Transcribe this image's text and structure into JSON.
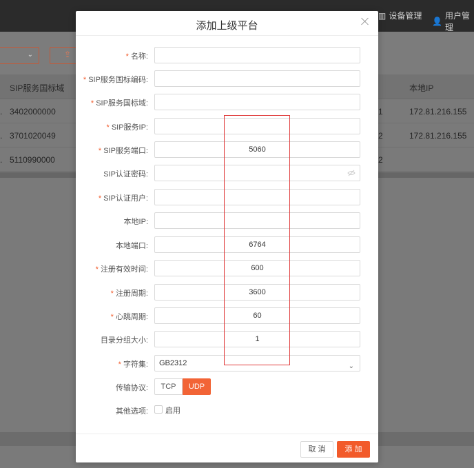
{
  "topnav": {
    "device_mgmt": "设备管理",
    "user_mgmt": "用户管理"
  },
  "bg_table": {
    "headers": [
      "SIP服务国标域",
      "本地IP"
    ],
    "rows": [
      {
        "prefix": ".",
        "domain": "3402000000",
        "mid": "1",
        "ip": "172.81.216.155"
      },
      {
        "prefix": ".",
        "domain": "3701020049",
        "mid": "2",
        "ip": "172.81.216.155"
      },
      {
        "prefix": ".",
        "domain": "5110990000",
        "mid": "2",
        "ip": ""
      }
    ]
  },
  "dialog": {
    "title": "添加上级平台",
    "fields": [
      {
        "label": "名称:",
        "required": true,
        "value": ""
      },
      {
        "label": "SIP服务国标编码:",
        "required": true,
        "value": ""
      },
      {
        "label": "SIP服务国标域:",
        "required": true,
        "value": ""
      },
      {
        "label": "SIP服务IP:",
        "required": true,
        "value": ""
      },
      {
        "label": "SIP服务端口:",
        "required": true,
        "value": "5060"
      },
      {
        "label": "SIP认证密码:",
        "required": false,
        "value": ""
      },
      {
        "label": "SIP认证用户:",
        "required": true,
        "value": ""
      },
      {
        "label": "本地IP:",
        "required": false,
        "value": ""
      },
      {
        "label": "本地端口:",
        "required": false,
        "value": "6764"
      },
      {
        "label": "注册有效时间:",
        "required": true,
        "value": "600"
      },
      {
        "label": "注册周期:",
        "required": true,
        "value": "3600"
      },
      {
        "label": "心跳周期:",
        "required": true,
        "value": "60"
      },
      {
        "label": "目录分组大小:",
        "required": false,
        "value": "1"
      }
    ],
    "charset": {
      "label": "字符集:",
      "required": true,
      "value": "GB2312"
    },
    "protocol": {
      "label": "传输协议:",
      "options": [
        "TCP",
        "UDP"
      ],
      "selected": "UDP"
    },
    "other": {
      "label": "其他选项:",
      "checkbox_label": "启用",
      "checked": false
    },
    "buttons": {
      "cancel": "取 消",
      "add": "添 加"
    }
  },
  "colors": {
    "accent": "#f25a2a",
    "highlight_box": "#e03a3a"
  }
}
